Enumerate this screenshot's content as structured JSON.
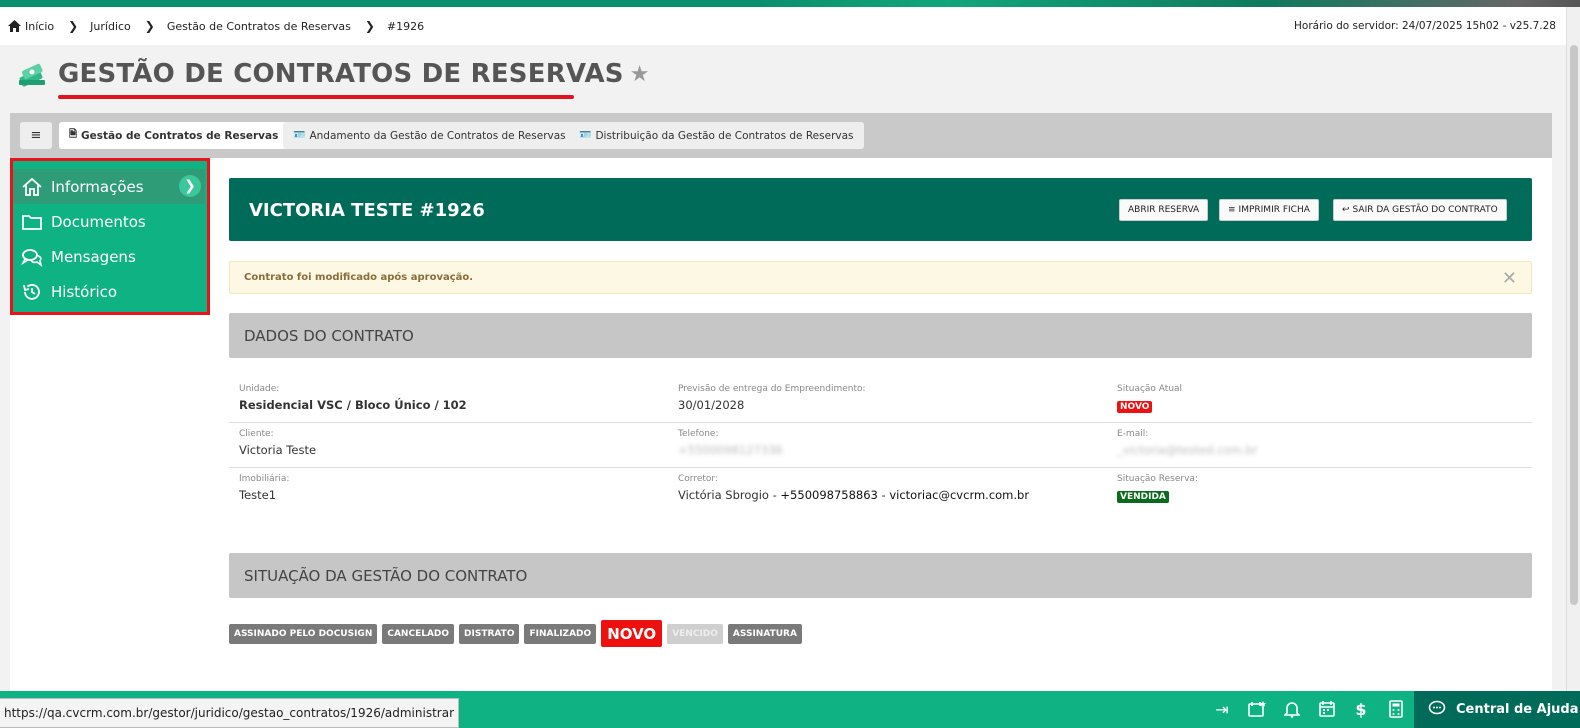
{
  "breadcrumb": {
    "items": [
      "Início",
      "Jurídico",
      "Gestão de Contratos de Reservas",
      "#1926"
    ],
    "server_time": "Horário do servidor: 24/07/2025 15h02 - v25.7.28"
  },
  "page": {
    "title": "GESTÃO DE CONTRATOS DE RESERVAS"
  },
  "tabs": [
    {
      "label": "Gestão de Contratos de Reservas",
      "active": true
    },
    {
      "label": "Andamento da Gestão de Contratos de Reservas",
      "active": false
    },
    {
      "label": "Distribuição da Gestão de Contratos de Reservas",
      "active": false
    }
  ],
  "sidebar": {
    "items": [
      {
        "label": "Informações",
        "icon": "home-icon",
        "active": true
      },
      {
        "label": "Documentos",
        "icon": "folder-icon",
        "active": false
      },
      {
        "label": "Mensagens",
        "icon": "chat-icon",
        "active": false
      },
      {
        "label": "Histórico",
        "icon": "history-icon",
        "active": false
      }
    ]
  },
  "contract": {
    "name": "VICTORIA TESTE #1926",
    "buttons": {
      "open": "ABRIR RESERVA",
      "print": "IMPRIMIR FICHA",
      "exit": "SAIR DA GESTÃO DO CONTRATO"
    }
  },
  "alert": {
    "message": "Contrato foi modificado após aprovação."
  },
  "sections": {
    "data": "DADOS DO CONTRATO",
    "status": "SITUAÇÃO DA GESTÃO DO CONTRATO"
  },
  "fields": {
    "unidade": {
      "label": "Unidade:",
      "value": "Residencial VSC / Bloco Único / 102"
    },
    "previsao": {
      "label": "Previsão de entrega do Empreendimento:",
      "value": "30/01/2028"
    },
    "situacao_atual": {
      "label": "Situação Atual",
      "value": "NOVO"
    },
    "cliente": {
      "label": "Cliente:",
      "value": "Victoria Teste"
    },
    "telefone": {
      "label": "Telefone:",
      "value": "+5500098127336"
    },
    "email": {
      "label": "E-mail:",
      "value": "_victoria@tested.com.br"
    },
    "imobiliaria": {
      "label": "Imobiliária:",
      "value": "Teste1"
    },
    "corretor": {
      "label": "Corretor:",
      "name": "Victória Sbrogio",
      "sep": " - ",
      "phone": "+550098758863",
      "mail": "victoriac@cvcrm.com.br"
    },
    "situacao_reserva": {
      "label": "Situação Reserva:",
      "value": "VENDIDA"
    }
  },
  "status_pills": [
    {
      "label": "ASSINADO PELO DOCUSIGN"
    },
    {
      "label": "CANCELADO"
    },
    {
      "label": "DISTRATO"
    },
    {
      "label": "FINALIZADO"
    },
    {
      "label": "NOVO"
    },
    {
      "label": "VENCIDO"
    },
    {
      "label": "ASSINATURA"
    }
  ],
  "statusbar": {
    "url": "https://qa.cvcrm.com.br/gestor/juridico/gestao_contratos/1926/administrar",
    "help": "Central de Ajuda"
  },
  "colors": {
    "brand_green": "#0fb383",
    "dark_green": "#006b58",
    "alert_red": "#ee1111"
  }
}
